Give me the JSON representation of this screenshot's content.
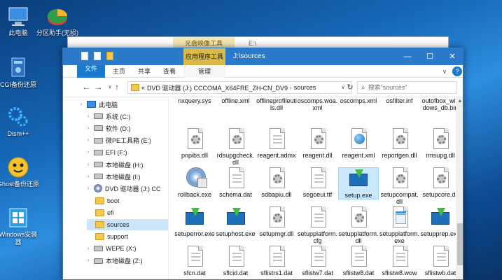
{
  "desktop": {
    "icons": [
      {
        "label": "此电脑",
        "icon": "computer-icon"
      },
      {
        "label": "分区助手(无损)",
        "icon": "partition-tool-icon"
      },
      {
        "label": "CGI备份还原",
        "icon": "backup-icon"
      },
      {
        "label": "Dism++",
        "icon": "gears-icon"
      },
      {
        "label": "Ghost备份还原",
        "icon": "ghost-icon"
      },
      {
        "label": "Windows安装器",
        "icon": "windows-installer-icon"
      }
    ]
  },
  "background_window": {
    "ribbon_tab": "光盘映像工具",
    "title": "E:\\"
  },
  "window": {
    "context_tab": "应用程序工具",
    "title": "J:\\sources",
    "controls": {
      "minimize": "—",
      "maximize": "☐",
      "close": "✕"
    }
  },
  "ribbon": {
    "tabs": [
      "文件",
      "主页",
      "共享",
      "查看",
      "管理"
    ],
    "expand": "∨",
    "help": "?"
  },
  "address": {
    "back": "←",
    "forward": "→",
    "up": "↑",
    "history": "∨",
    "prefix": "«",
    "path": [
      "DVD 驱动器 (J:) CCCOMA_X64FRE_ZH-CN_DV9",
      "sources"
    ],
    "separator": "›",
    "dropdown": "∨",
    "refresh": "↻"
  },
  "search": {
    "placeholder": "搜索\"sources\"",
    "icon": "⌕"
  },
  "nav": {
    "items": [
      {
        "label": "此电脑",
        "icon": "pc-icon",
        "indent": 0
      },
      {
        "label": "系统 (C:)",
        "icon": "drive-icon",
        "indent": 1
      },
      {
        "label": "软件 (D:)",
        "icon": "drive-icon",
        "indent": 1
      },
      {
        "label": "微PE工具箱 (E:)",
        "icon": "drive-icon",
        "indent": 1
      },
      {
        "label": "EFI (F:)",
        "icon": "drive-icon",
        "indent": 1
      },
      {
        "label": "本地磁盘 (H:)",
        "icon": "drive-icon",
        "indent": 1
      },
      {
        "label": "本地磁盘 (I:)",
        "icon": "drive-icon",
        "indent": 1
      },
      {
        "label": "DVD 驱动器 (J:) CC",
        "icon": "dvd-icon",
        "indent": 1
      },
      {
        "label": "boot",
        "icon": "folder-icon",
        "indent": 2
      },
      {
        "label": "efi",
        "icon": "folder-icon",
        "indent": 2
      },
      {
        "label": "sources",
        "icon": "folder-icon",
        "indent": 2,
        "selected": true
      },
      {
        "label": "support",
        "icon": "folder-icon",
        "indent": 2
      },
      {
        "label": "WEPE (X:)",
        "icon": "drive-icon",
        "indent": 1
      },
      {
        "label": "本地磁盘 (Z:)",
        "icon": "drive-icon",
        "indent": 1
      }
    ]
  },
  "files": [
    {
      "name": "nxquery.sys",
      "type": "sys"
    },
    {
      "name": "offline.xml",
      "type": "xml"
    },
    {
      "name": "offlineprofileutils.dll",
      "type": "dll"
    },
    {
      "name": "oscomps.woa.xml",
      "type": "xml"
    },
    {
      "name": "oscomps.xml",
      "type": "xml"
    },
    {
      "name": "osfilter.inf",
      "type": "inf"
    },
    {
      "name": "outofbox_windows_db.bin",
      "type": "bin"
    },
    {
      "name": "pnpibs.dll",
      "type": "dll"
    },
    {
      "name": "rdsupgcheck.dll",
      "type": "dll"
    },
    {
      "name": "reagent.admx",
      "type": "doc"
    },
    {
      "name": "reagent.dll",
      "type": "dll"
    },
    {
      "name": "reagent.xml",
      "type": "xml-web"
    },
    {
      "name": "reportgen.dll",
      "type": "dll"
    },
    {
      "name": "rmsupg.dll",
      "type": "dll"
    },
    {
      "name": "rollback.exe",
      "type": "disc"
    },
    {
      "name": "schema.dat",
      "type": "doc"
    },
    {
      "name": "sdbapiu.dll",
      "type": "dll"
    },
    {
      "name": "segoeui.ttf",
      "type": "doc"
    },
    {
      "name": "setup.exe",
      "type": "setup",
      "selected": true
    },
    {
      "name": "setupcompat.dll",
      "type": "dll"
    },
    {
      "name": "setupcore.dll",
      "type": "dll"
    },
    {
      "name": "setuperror.exe",
      "type": "setup"
    },
    {
      "name": "setuphost.exe",
      "type": "setup"
    },
    {
      "name": "setupmgr.dll",
      "type": "dll"
    },
    {
      "name": "setupplatform.cfg",
      "type": "doc"
    },
    {
      "name": "setupplatform.dll",
      "type": "dll"
    },
    {
      "name": "setupplatform.exe",
      "type": "exe"
    },
    {
      "name": "setupprep.exe",
      "type": "setup"
    },
    {
      "name": "sfcn.dat",
      "type": "doc"
    },
    {
      "name": "sflcid.dat",
      "type": "doc"
    },
    {
      "name": "sflistrs1.dat",
      "type": "doc"
    },
    {
      "name": "sflistw7.dat",
      "type": "doc"
    },
    {
      "name": "sflistw8.dat",
      "type": "doc"
    },
    {
      "name": "sflistw8.wow",
      "type": "doc"
    },
    {
      "name": "sflistwb.dat",
      "type": "doc"
    }
  ]
}
